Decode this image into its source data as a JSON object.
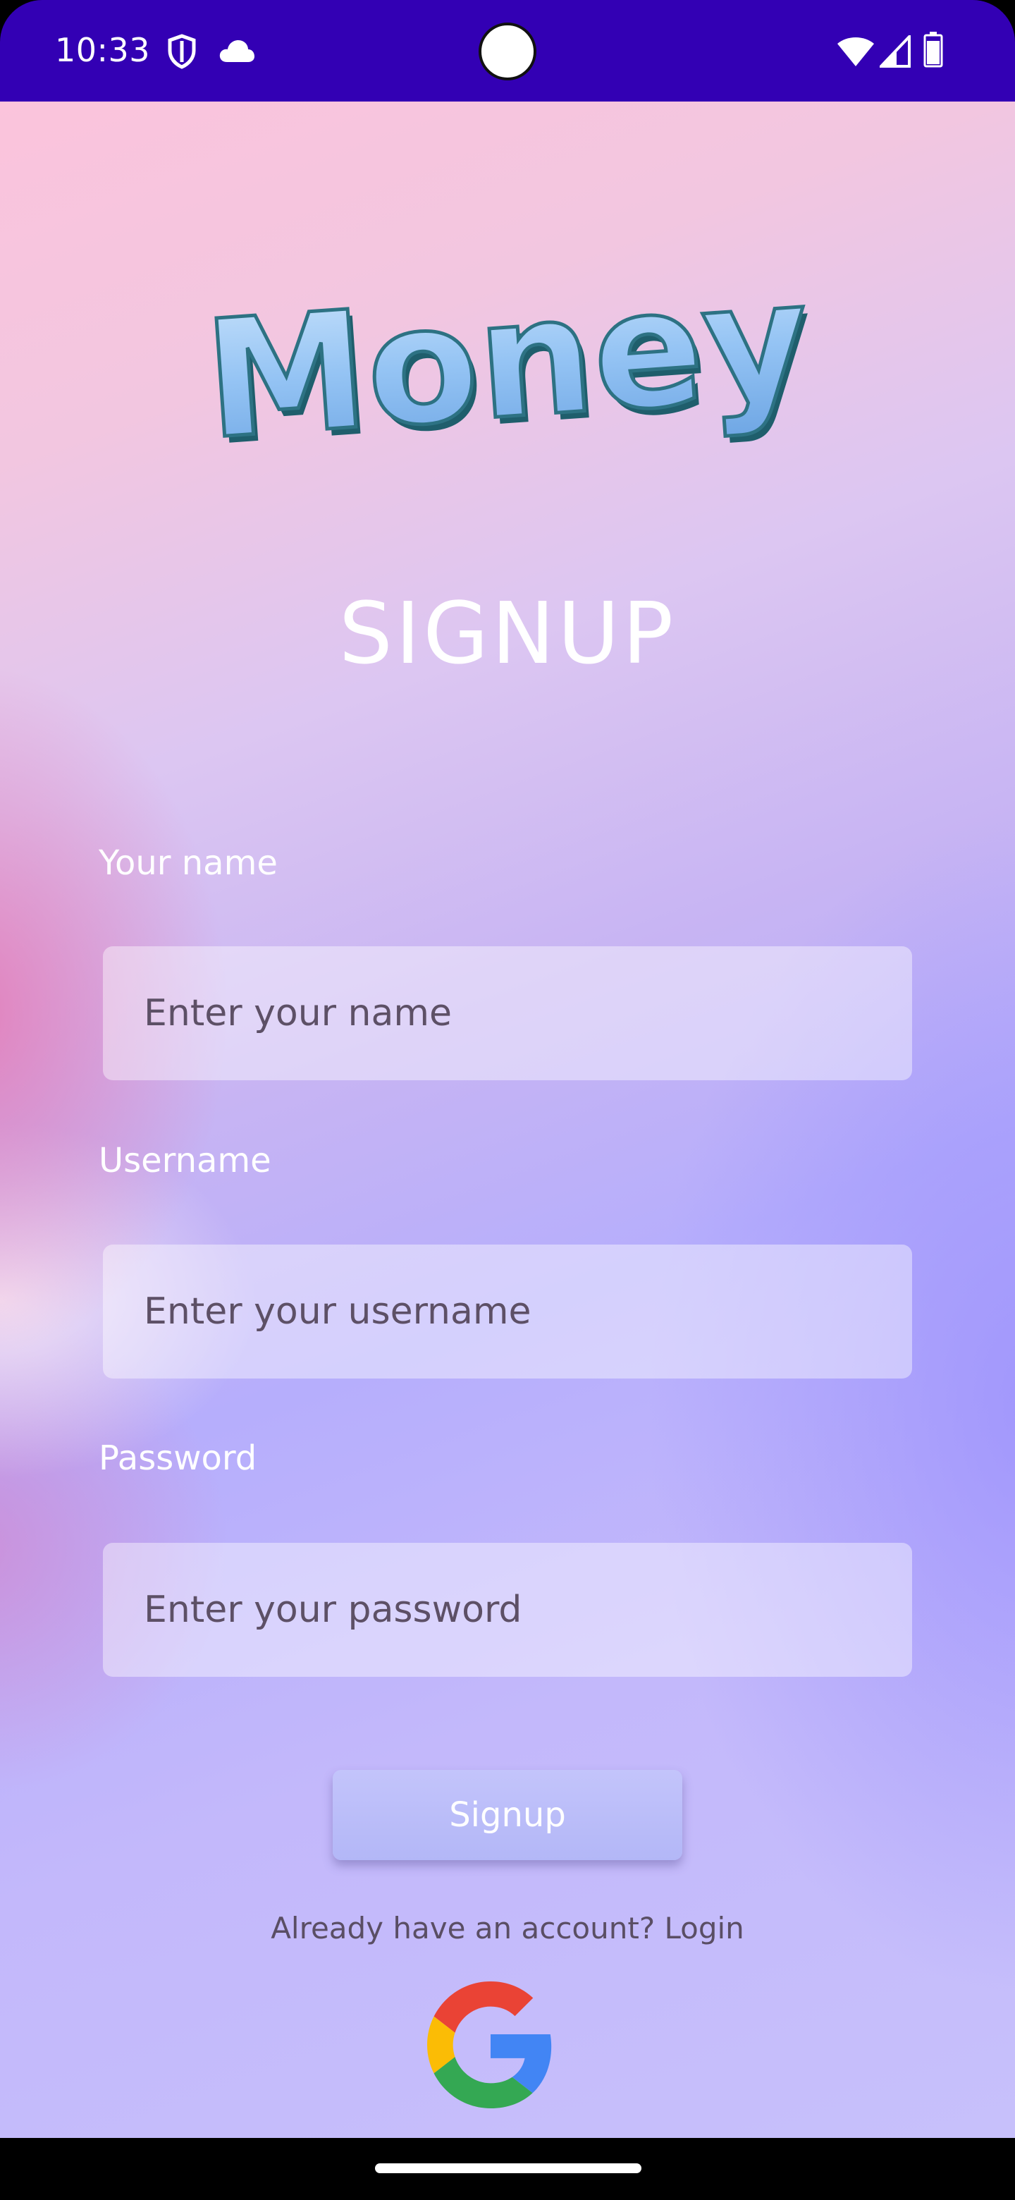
{
  "status_bar": {
    "time": "10:33",
    "icons": [
      "shield-icon",
      "cloud-icon",
      "wifi-icon",
      "signal-icon",
      "battery-icon"
    ],
    "background_color": "#3300b4"
  },
  "logo": {
    "text": "Money"
  },
  "page_title": "SIGNUP",
  "form": {
    "name": {
      "label": "Your name",
      "placeholder": "Enter your name",
      "value": ""
    },
    "username": {
      "label": "Username",
      "placeholder": "Enter your username",
      "value": ""
    },
    "password": {
      "label": "Password",
      "placeholder": "Enter your password",
      "value": ""
    }
  },
  "signup_button_label": "Signup",
  "login_prompt": "Already have an account? Login",
  "google_button": {
    "icon": "google-icon"
  },
  "colors": {
    "accent_purple": "#3300b4",
    "logo_blue": "#8fc0f3",
    "google_blue": "#4285F4",
    "google_red": "#EA4335",
    "google_yellow": "#FBBC05",
    "google_green": "#34A853"
  }
}
